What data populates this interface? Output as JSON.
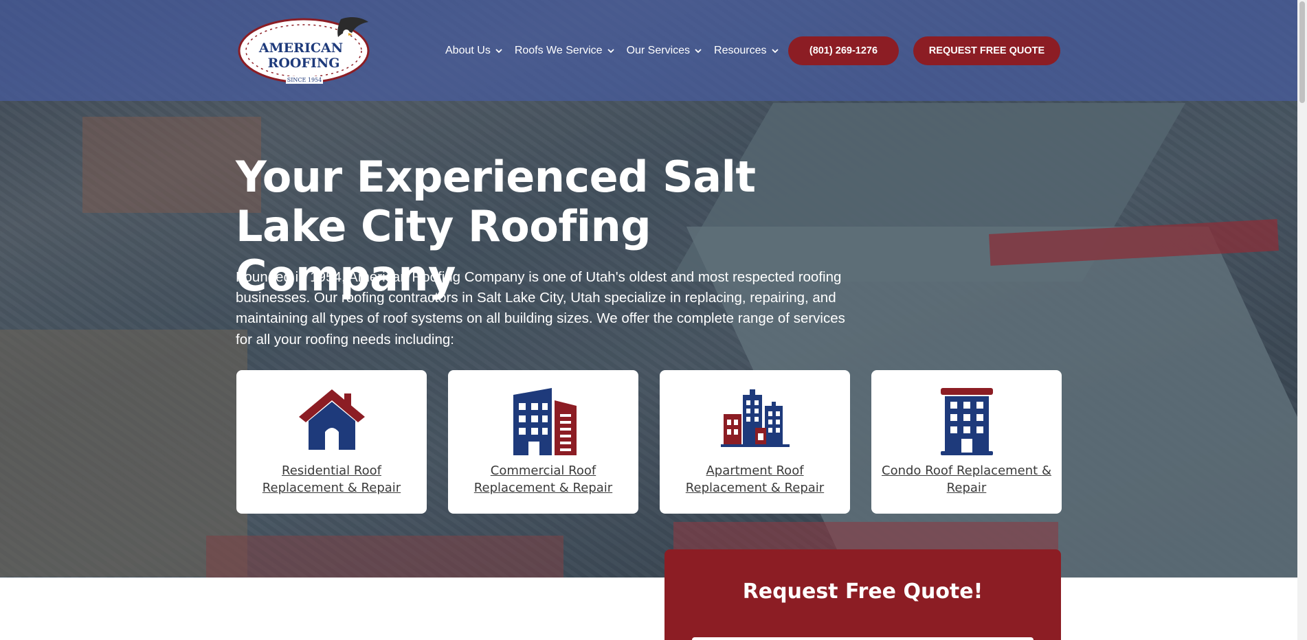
{
  "header": {
    "logo": {
      "text_line1": "AMERICAN",
      "text_line2": "ROOFING",
      "since": "SINCE 1954",
      "icon": "eagle-logo-icon"
    },
    "nav": [
      {
        "label": "About Us",
        "icon": "chevron-down-icon"
      },
      {
        "label": "Roofs We Service",
        "icon": "chevron-down-icon"
      },
      {
        "label": "Our Services",
        "icon": "chevron-down-icon"
      },
      {
        "label": "Resources",
        "icon": "chevron-down-icon"
      }
    ],
    "phone_button": "(801) 269-1276",
    "quote_button": "REQUEST FREE QUOTE"
  },
  "hero": {
    "title": "Your Experienced Salt Lake City Roofing Company",
    "description": "Founded in 1954, American Roofing Company is one of Utah's oldest and most respected roofing businesses. Our roofing contractors in Salt Lake City, Utah specialize in replacing, repairing, and maintaining all types of roof systems on all building sizes. We offer the complete range of services for all your roofing needs including:"
  },
  "services": [
    {
      "label": "Residential Roof Replacement & Repair",
      "icon": "house-icon"
    },
    {
      "label": "Commercial Roof Replacement & Repair",
      "icon": "commercial-building-icon"
    },
    {
      "label": "Apartment Roof Replacement & Repair",
      "icon": "apartment-buildings-icon"
    },
    {
      "label": "Condo Roof Replacement & Repair",
      "icon": "condo-building-icon"
    }
  ],
  "quote_panel": {
    "title": "Request Free Quote!"
  },
  "colors": {
    "brand_red": "#8c1d24",
    "brand_navy": "#1e3a7b",
    "header_overlay": "#465ca0",
    "card_bg": "#ffffff"
  }
}
